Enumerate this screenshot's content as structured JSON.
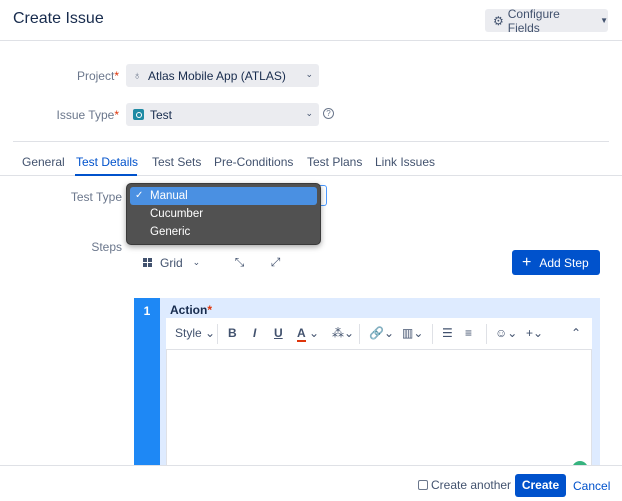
{
  "header": {
    "title": "Create Issue",
    "configure_fields_label": "Configure Fields"
  },
  "form": {
    "project": {
      "label": "Project",
      "value": "Atlas Mobile App (ATLAS)"
    },
    "issue_type": {
      "label": "Issue Type",
      "value": "Test"
    }
  },
  "tabs": [
    {
      "label": "General"
    },
    {
      "label": "Test Details"
    },
    {
      "label": "Test Sets"
    },
    {
      "label": "Pre-Conditions"
    },
    {
      "label": "Test Plans"
    },
    {
      "label": "Link Issues"
    }
  ],
  "active_tab": "Test Details",
  "test_details": {
    "test_type_label": "Test Type",
    "test_type_options": [
      "Manual",
      "Cucumber",
      "Generic"
    ],
    "test_type_selected": "Manual",
    "steps_label": "Steps",
    "view_mode": "Grid",
    "add_step_label": "Add Step",
    "step": {
      "number": "1",
      "action_label": "Action"
    },
    "toolbar": {
      "style_label": "Style",
      "bold": "B",
      "italic": "I",
      "underline": "U",
      "text_color": "A"
    }
  },
  "footer": {
    "create_another_label": "Create another",
    "create_label": "Create",
    "cancel_label": "Cancel"
  },
  "colors": {
    "primary": "#0052cc",
    "required": "#de350b",
    "step_accent": "#1e88f5"
  }
}
